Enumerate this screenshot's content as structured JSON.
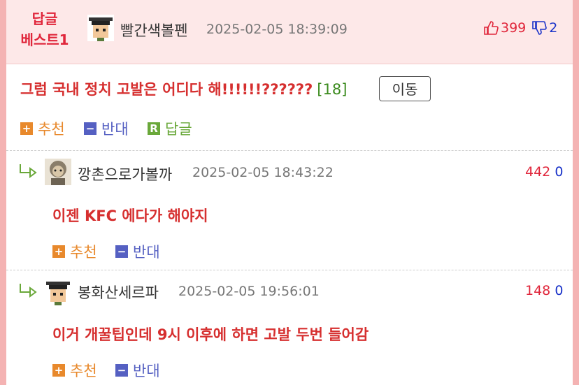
{
  "best": {
    "label_line1": "답글",
    "label_line2": "베스트1",
    "author": "빨간색볼펜",
    "date": "2025-02-05 18:39:09",
    "up_count": "399",
    "down_count": "2",
    "title": "그럼 국내 정치 고발은 어디다 해!!!!!!??????",
    "reply_count": "[18]",
    "move_label": "이동",
    "actions": {
      "recommend": "추천",
      "oppose": "반대",
      "reply": "답글",
      "reply_badge": "R"
    }
  },
  "replies": [
    {
      "author": "깡촌으로가볼까",
      "date": "2025-02-05 18:43:22",
      "up": "442",
      "down": "0",
      "text": "이젠 KFC 에다가 해야지",
      "recommend": "추천",
      "oppose": "반대"
    },
    {
      "author": "봉화산세르파",
      "date": "2025-02-05 19:56:01",
      "up": "148",
      "down": "0",
      "text": "이거 개꿀팁인데 9시 이후에 하면 고발 두번 들어감",
      "recommend": "추천",
      "oppose": "반대"
    }
  ],
  "icons": {
    "thumbs_up": "thumbs-up-icon",
    "thumbs_down": "thumbs-down-icon",
    "reply_arrow": "reply-arrow-icon",
    "plus": "plus-icon",
    "minus": "minus-icon"
  },
  "colors": {
    "page_bg": "#f4b3b3",
    "best_bg": "#fde8e8",
    "red": "#e0263b",
    "blue": "#1a33c9",
    "orange": "#e8892c",
    "purple_blue": "#5560c2",
    "green": "#6aa83a"
  }
}
